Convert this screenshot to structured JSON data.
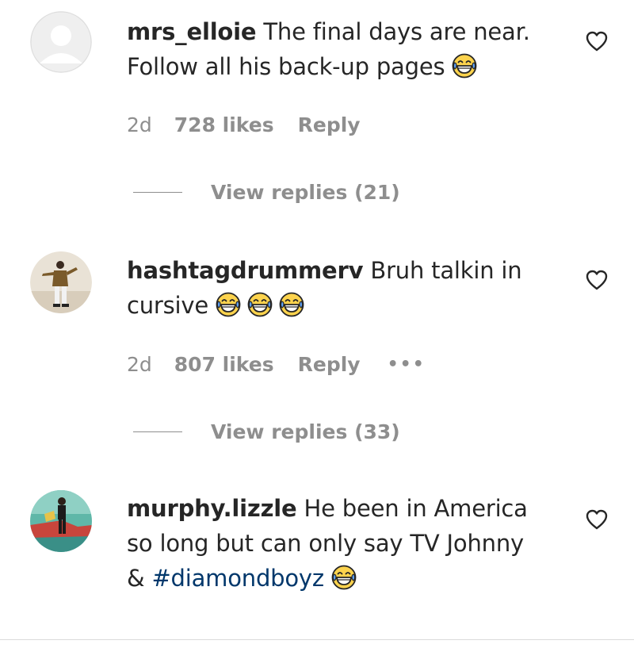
{
  "comments": [
    {
      "username": "mrs_elloie",
      "text_part1": "The final days are near.",
      "text_part2": "Follow all his back-up pages",
      "emoji_count": 1,
      "time": "2d",
      "likes": "728 likes",
      "reply": "Reply",
      "view_replies": "View replies (21)"
    },
    {
      "username": "hashtagdrummerv",
      "text_part1": "Bruh talkin in",
      "text_part2": "cursive",
      "emoji_count": 3,
      "time": "2d",
      "likes": "807 likes",
      "reply": "Reply",
      "more": "•••",
      "view_replies": "View replies (33)"
    },
    {
      "username": "murphy.lizzle",
      "text_part1": "He been in America",
      "text_part2": "so long but can only say TV Johnny",
      "text_part3": "& ",
      "hashtag": "#diamondboyz",
      "emoji_count": 1
    }
  ],
  "icons": {
    "like": "heart-outline-icon",
    "emoji": "face-with-tears-of-joy-emoji"
  },
  "colors": {
    "text": "#262626",
    "secondary": "#8e8e8e",
    "hashtag": "#00376b",
    "divider": "#dbdbdb"
  }
}
